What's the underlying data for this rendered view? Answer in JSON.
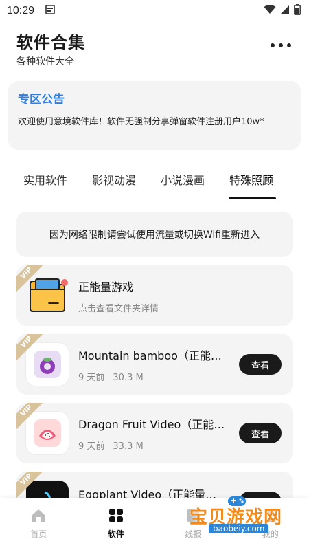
{
  "status_bar": {
    "time": "10:29"
  },
  "header": {
    "title": "软件合集",
    "subtitle": "各种软件大全"
  },
  "notice": {
    "title": "专区公告",
    "body": "欢迎使用意境软件库！软件无强制分享弹窗软件注册用户10w*"
  },
  "tabs": [
    {
      "label": "实用软件"
    },
    {
      "label": "影视动漫"
    },
    {
      "label": "小说漫画"
    },
    {
      "label": "特殊照顾",
      "active": true
    }
  ],
  "tip": "因为网络限制请尝试使用流量或切换Wifi重新进入",
  "folder": {
    "name": "正能量游戏",
    "desc": "点击查看文件夹详情",
    "badge": "VIP"
  },
  "apps": [
    {
      "name": "Mountain bamboo（正能…",
      "time": "9 天前",
      "size": "30.3 M",
      "button": "查看",
      "badge": "VIP",
      "icon": "mangosteen-icon"
    },
    {
      "name": "Dragon Fruit Video（正能…",
      "time": "9 天前",
      "size": "33.3 M",
      "button": "查看",
      "badge": "VIP",
      "icon": "dragon-fruit-icon"
    },
    {
      "name": "Eggplant Video（正能量…",
      "time": "",
      "size": "",
      "button": "查看",
      "badge": "VIP",
      "icon": "eggplant-icon"
    }
  ],
  "bottom_nav": [
    {
      "label": "首页",
      "icon": "home-icon"
    },
    {
      "label": "软件",
      "icon": "grid-icon",
      "active": true
    },
    {
      "label": "线报",
      "icon": "news-icon"
    },
    {
      "label": "我的",
      "icon": "user-icon"
    }
  ],
  "watermark": {
    "text": "宝贝游戏网",
    "url": "baobeiy.com"
  },
  "colors": {
    "accent_blue": "#2f7ee0",
    "vip_gold": "#d9c39a",
    "button_dark": "#1a1a1a",
    "card_bg": "#f4f4f4"
  }
}
